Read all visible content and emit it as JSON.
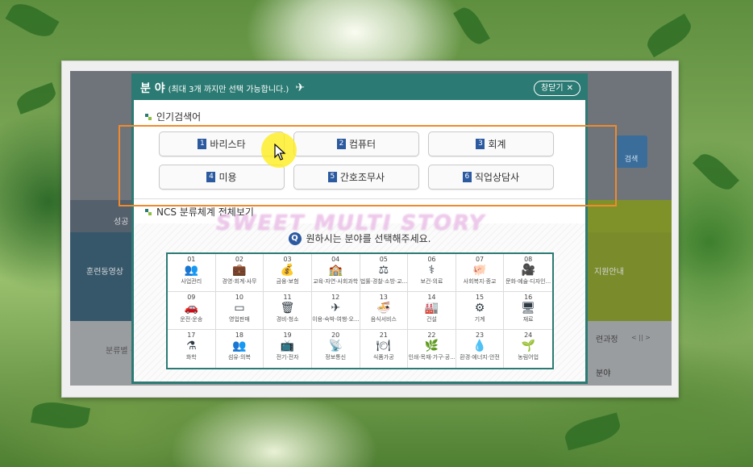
{
  "background_site": {
    "left_texts": [
      "성공",
      "훈련동영상",
      "분류별 검"
    ],
    "right_texts": [
      "지원안내",
      "련과정",
      "분야"
    ],
    "search_label": "검색",
    "nav_arrows": "< || >"
  },
  "popup": {
    "title": "분 야",
    "subtitle": "(최대 3개 까지만 선택 가능합니다.)",
    "close_label": "창닫기",
    "popular_heading": "인기검색어",
    "keywords": [
      {
        "num": "1",
        "label": "바리스타"
      },
      {
        "num": "2",
        "label": "컴퓨터"
      },
      {
        "num": "3",
        "label": "회계"
      },
      {
        "num": "4",
        "label": "미용"
      },
      {
        "num": "5",
        "label": "간호조무사"
      },
      {
        "num": "6",
        "label": "직업상담사"
      }
    ],
    "ncs_heading": "NCS 분류체계 전체보기",
    "ncs_question": "원하시는 분야를 선택해주세요.",
    "ncs_categories": [
      {
        "num": "01",
        "label": "사업관리",
        "icon": "people-icon"
      },
      {
        "num": "02",
        "label": "경영·회계·사무",
        "icon": "briefcase-icon"
      },
      {
        "num": "03",
        "label": "금융·보험",
        "icon": "money-icon"
      },
      {
        "num": "04",
        "label": "교육·자연·사회과학",
        "icon": "school-icon"
      },
      {
        "num": "05",
        "label": "법률·경찰·소방·교...",
        "icon": "gavel-icon"
      },
      {
        "num": "06",
        "label": "보건·의료",
        "icon": "nurse-icon"
      },
      {
        "num": "07",
        "label": "사회복지·종교",
        "icon": "piggy-bank-icon"
      },
      {
        "num": "08",
        "label": "문화·예술·디자인...",
        "icon": "camera-icon"
      },
      {
        "num": "09",
        "label": "운전·운송",
        "icon": "car-icon"
      },
      {
        "num": "10",
        "label": "영업판매",
        "icon": "sold-tag-icon"
      },
      {
        "num": "11",
        "label": "경비·청소",
        "icon": "trash-icon"
      },
      {
        "num": "12",
        "label": "이용·숙박·여행·오...",
        "icon": "airplane-icon"
      },
      {
        "num": "13",
        "label": "음식서비스",
        "icon": "bowl-icon"
      },
      {
        "num": "14",
        "label": "건설",
        "icon": "building-icon"
      },
      {
        "num": "15",
        "label": "기계",
        "icon": "gear-icon"
      },
      {
        "num": "16",
        "label": "재료",
        "icon": "monitor-icon"
      },
      {
        "num": "17",
        "label": "화학",
        "icon": "test-tube-icon"
      },
      {
        "num": "18",
        "label": "섬유·의복",
        "icon": "people-icon"
      },
      {
        "num": "19",
        "label": "전기·전자",
        "icon": "tv-icon"
      },
      {
        "num": "20",
        "label": "정보통신",
        "icon": "satellite-icon"
      },
      {
        "num": "21",
        "label": "식품가공",
        "icon": "plate-icon"
      },
      {
        "num": "22",
        "label": "인쇄·목재·가구·공...",
        "icon": "leaf-icon"
      },
      {
        "num": "23",
        "label": "환경·에너지·안전",
        "icon": "drops-icon"
      },
      {
        "num": "24",
        "label": "농림어업",
        "icon": "plant-icon"
      }
    ]
  },
  "watermark": "SWEET MULTI STORY",
  "colors": {
    "header": "#2b7a73",
    "number_badge": "#2c5aa0",
    "highlight": "#f08a2c",
    "cursor_halo": "#ffee1e"
  }
}
